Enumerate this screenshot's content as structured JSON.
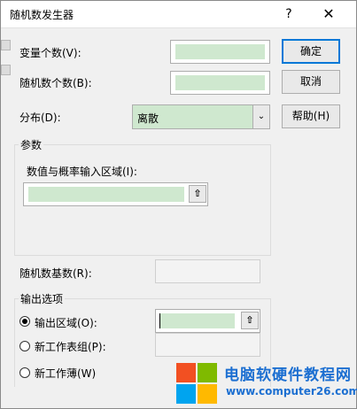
{
  "window": {
    "title": "随机数发生器",
    "help_glyph": "?",
    "close_glyph": "✕"
  },
  "fields": {
    "variables": {
      "label": "变量个数(V):"
    },
    "count": {
      "label": "随机数个数(B):"
    },
    "distribution": {
      "label": "分布(D):",
      "value": "离散"
    },
    "seed": {
      "label": "随机数基数(R):"
    }
  },
  "buttons": {
    "ok": "确定",
    "cancel": "取消",
    "help": "帮助(H)"
  },
  "params": {
    "title": "参数",
    "range_label": "数值与概率输入区域(I):",
    "ref_glyph": "⇧"
  },
  "output": {
    "title": "输出选项",
    "options": [
      {
        "label": "输出区域(O):",
        "selected": true
      },
      {
        "label": "新工作表组(P):",
        "selected": false
      },
      {
        "label": "新工作薄(W)",
        "selected": false
      }
    ]
  },
  "brand": {
    "text": "电脑软硬件教程网",
    "url": "www.computer26.com",
    "colors": [
      "#f25022",
      "#7fba00",
      "#00a4ef",
      "#ffb900"
    ]
  }
}
